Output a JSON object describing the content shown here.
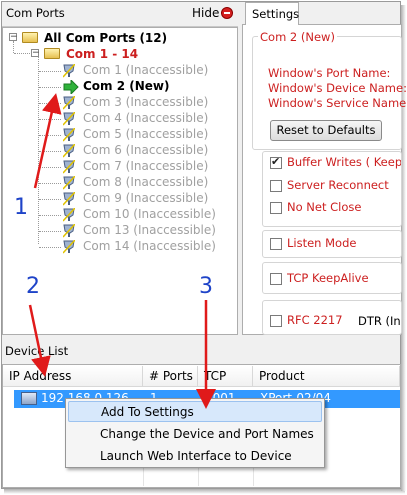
{
  "com_ports_panel": {
    "title": "Com Ports",
    "hide_label": "Hide",
    "tree": {
      "root_label": "All Com Ports (12)",
      "group_label": "Com 1 - 14",
      "ports": [
        {
          "label": "Com 1 (Inaccessible)",
          "state": "inaccessible"
        },
        {
          "label": "Com 2 (New)",
          "state": "new"
        },
        {
          "label": "Com 3 (Inaccessible)",
          "state": "inaccessible"
        },
        {
          "label": "Com 4 (Inaccessible)",
          "state": "inaccessible"
        },
        {
          "label": "Com 5 (Inaccessible)",
          "state": "inaccessible"
        },
        {
          "label": "Com 6 (Inaccessible)",
          "state": "inaccessible"
        },
        {
          "label": "Com 7 (Inaccessible)",
          "state": "inaccessible"
        },
        {
          "label": "Com 8 (Inaccessible)",
          "state": "inaccessible"
        },
        {
          "label": "Com 9 (Inaccessible)",
          "state": "inaccessible"
        },
        {
          "label": "Com 10 (Inaccessible)",
          "state": "inaccessible"
        },
        {
          "label": "Com 13 (Inaccessible)",
          "state": "inaccessible"
        },
        {
          "label": "Com 14 (Inaccessible)",
          "state": "inaccessible"
        }
      ]
    }
  },
  "settings_panel": {
    "tab_label": "Settings",
    "group_title": "Com 2 (New)",
    "windows_port_name_label": "Window's Port Name:",
    "windows_device_name_label": "Window's Device Name:",
    "windows_service_name_label": "Window's Service Name:",
    "reset_button": "Reset to Defaults",
    "checkboxes": [
      {
        "label": "Buffer Writes  ( Keep C",
        "checked": true
      },
      {
        "label": "Server Reconnect",
        "checked": false
      },
      {
        "label": "No Net Close",
        "checked": false
      },
      {
        "label": "Listen Mode",
        "checked": false
      },
      {
        "label": "TCP KeepAlive",
        "checked": false
      },
      {
        "label": "RFC 2217",
        "checked": false
      }
    ],
    "dtr_label": "DTR (In"
  },
  "device_list": {
    "title": "Device List",
    "columns": [
      "IP Address",
      "# Ports",
      "TCP Port",
      "Product"
    ],
    "selected_row": {
      "ip": "192.168.0.126",
      "ports": "1",
      "tcp_port": "4001",
      "product": "XPort-02/04"
    }
  },
  "context_menu": {
    "items": [
      "Add To Settings",
      "Change the Device and Port Names",
      "Launch Web Interface to Device"
    ]
  },
  "callouts": [
    "1",
    "2",
    "3"
  ],
  "colors": {
    "accent_red": "#cc1f1f",
    "selection_blue": "#3399ff",
    "callout_blue": "#1e43c8",
    "arrow_red": "#e01a1a"
  }
}
